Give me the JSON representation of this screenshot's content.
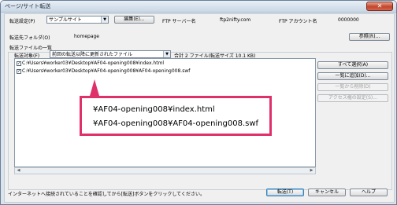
{
  "window": {
    "title": "ページ/サイト転送",
    "close_glyph": "✕"
  },
  "site_row": {
    "label": "転送設定(P)",
    "site_value": "サンプルサイト",
    "edit_button": "編集(E)...",
    "ftp_server_label": "FTP サーバー名",
    "ftp_server_value": "ftp2nifty.com",
    "ftp_account_label": "FTP アカウント名",
    "ftp_account_value": "0000000"
  },
  "folder_row": {
    "label": "転送先フォルダ(O)",
    "value": "homepage",
    "browse_button": "参照(R)..."
  },
  "file_list": {
    "group_label": "転送ファイルの一覧",
    "target_label": "転送対象(F)",
    "target_value": "前回の転送以降に更新されたファイル",
    "summary": "合計 2 ファイル(転送サイズ 10.1 KB)",
    "items": [
      {
        "checked": true,
        "path": "C:¥Users¥worker03¥Desktop¥AF04-opening008¥index.html"
      },
      {
        "checked": true,
        "path": "C:¥Users¥worker03¥Desktop¥AF04-opening008¥AF04-opening008.swf"
      }
    ]
  },
  "side_buttons": {
    "select_all": "すべて選択(A)",
    "add": "一覧に追加(D)...",
    "remove": "一覧から削除(D)",
    "access_rights": "アクセス権の設定(S)..."
  },
  "callout": {
    "line1": "¥AF04-opening008¥index.html",
    "line2": "¥AF04-opening008¥AF04-opening008.swf"
  },
  "footer": {
    "status": "インターネットへ接続されていることを確認してから[転送]ボタンをクリックしてください。",
    "transfer_button": "転送(T)",
    "cancel_button": "キャンセル",
    "help_button": "ヘルプ"
  },
  "icons": {
    "checkbox_check": "✓",
    "dropdown_arrow": "▼",
    "scroll_left": "◀",
    "scroll_right": "▶"
  }
}
